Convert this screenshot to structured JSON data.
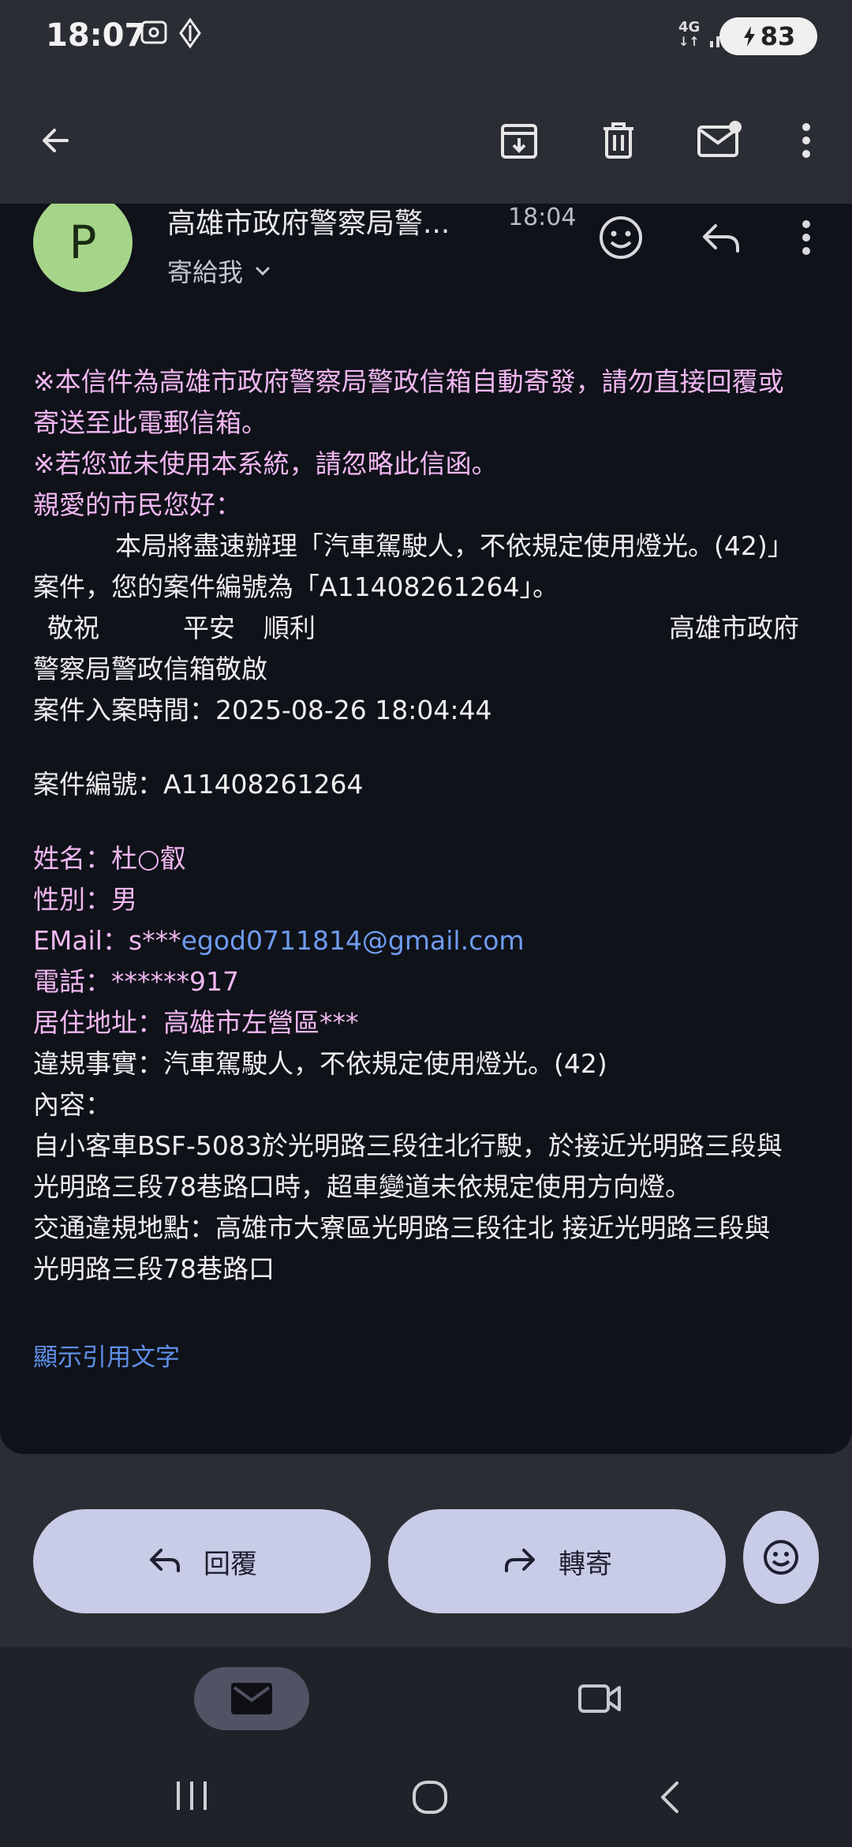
{
  "status_bar": {
    "time": "18:07",
    "network": "4G",
    "battery": "83",
    "icons": [
      "screenshot-icon",
      "navigation-icon",
      "network-4g-icon",
      "signal-icon",
      "battery-charging-icon"
    ]
  },
  "app_bar": {
    "icons": [
      "back-arrow-icon",
      "archive-icon",
      "delete-icon",
      "mark-unread-icon",
      "more-vert-icon"
    ]
  },
  "email": {
    "avatar_letter": "P",
    "sender": "高雄市政府警察局警...",
    "time": "18:04",
    "recipient": "寄給我",
    "lines": {
      "l1": "※本信件為高雄市政府警察局警政信箱自動寄發，請勿直接回覆或",
      "l2": "寄送至此電郵信箱。",
      "l3": "※若您並未使用本系統，請忽略此信函。",
      "l4": "親愛的市民您好：",
      "l5": "本局將盡速辦理「汽車駕駛人，不依規定使用燈光。(42)」",
      "l6": "案件，您的案件編號為「A11408261264」。",
      "l7a": "敬祝",
      "l7b": "平安",
      "l7c": "順利",
      "l7d": "高雄市政府",
      "l8": "警察局警政信箱敬啟",
      "l9": "案件入案時間：2025-08-26 18:04:44",
      "l10": "案件編號：A11408261264",
      "l11": "姓名：杜○叡",
      "l12": "性別：男",
      "l13a": "EMail：s***",
      "l13b": "egod0711814@gmail.com",
      "l14": "電話：******917",
      "l15": "居住地址：高雄市左營區***",
      "l16": "違規事實：汽車駕駛人，不依規定使用燈光。(42)",
      "l17": "內容：",
      "l18": "自小客車BSF-5083於光明路三段往北行駛，於接近光明路三段與",
      "l19": "光明路三段78巷路口時，超車變道未依規定使用方向燈。",
      "l20": "交通違規地點：高雄市大寮區光明路三段往北 接近光明路三段與",
      "l21": "光明路三段78巷路口"
    },
    "show_quoted": "顯示引用文字"
  },
  "actions": {
    "reply": "回覆",
    "forward": "轉寄"
  },
  "colors": {
    "background": "#2a2d33",
    "card": "#0f1219",
    "pink_text": "#f2b7f2",
    "link": "#6f9cf0",
    "avatar": "#a6d58a",
    "pill": "#c9cce6"
  }
}
